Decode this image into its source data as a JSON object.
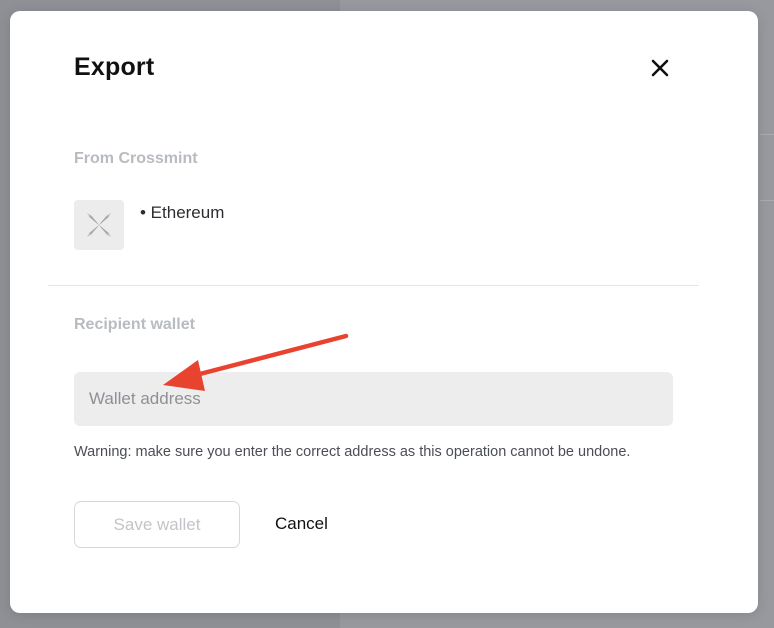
{
  "modal": {
    "title": "Export",
    "close_icon": "close-icon"
  },
  "source": {
    "label": "From Crossmint",
    "token_icon": "crossmint-logo-icon",
    "chain": "• Ethereum"
  },
  "recipient": {
    "label": "Recipient wallet",
    "input_value": "",
    "input_placeholder": "Wallet address",
    "warning": "Warning: make sure you enter the correct address as this operation cannot be undone."
  },
  "actions": {
    "save_label": "Save wallet",
    "save_state": "disabled",
    "cancel_label": "Cancel"
  },
  "annotation": {
    "type": "arrow",
    "color": "#e8432f",
    "points_to": "wallet-address-input"
  },
  "colors": {
    "backdrop": "#8e9096",
    "modal_bg": "#ffffff",
    "muted_label": "#b8bbc0",
    "input_bg": "#ededee",
    "arrow": "#e8432f"
  }
}
